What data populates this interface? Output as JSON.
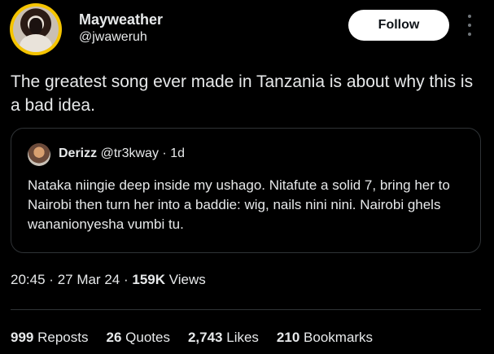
{
  "author": {
    "name": "Mayweather",
    "handle": "@jwaweruh"
  },
  "follow_label": "Follow",
  "tweet_text": "The greatest song ever made in Tanzania is about why this is a bad idea.",
  "quote": {
    "name": "Derizz",
    "handle": "@tr3kway",
    "dot": "·",
    "time": "1d",
    "text": "Nataka niingie deep inside my ushago. Nitafute a solid 7, bring her to Nairobi then turn her into a baddie: wig, nails nini nini. Nairobi ghels wananionyesha vumbi tu."
  },
  "meta": {
    "time": "20:45",
    "sep1": "·",
    "date": "27 Mar 24",
    "sep2": "·",
    "views_count": "159K",
    "views_label": "Views"
  },
  "stats": [
    {
      "count": "999",
      "label": "Reposts"
    },
    {
      "count": "26",
      "label": "Quotes"
    },
    {
      "count": "2,743",
      "label": "Likes"
    },
    {
      "count": "210",
      "label": "Bookmarks"
    }
  ],
  "colors": {
    "background": "#000000",
    "text": "#e7e9ea",
    "avatar_ring": "#f5c400",
    "border": "#2f3336"
  },
  "icons": [
    "more-vertical-icon"
  ]
}
